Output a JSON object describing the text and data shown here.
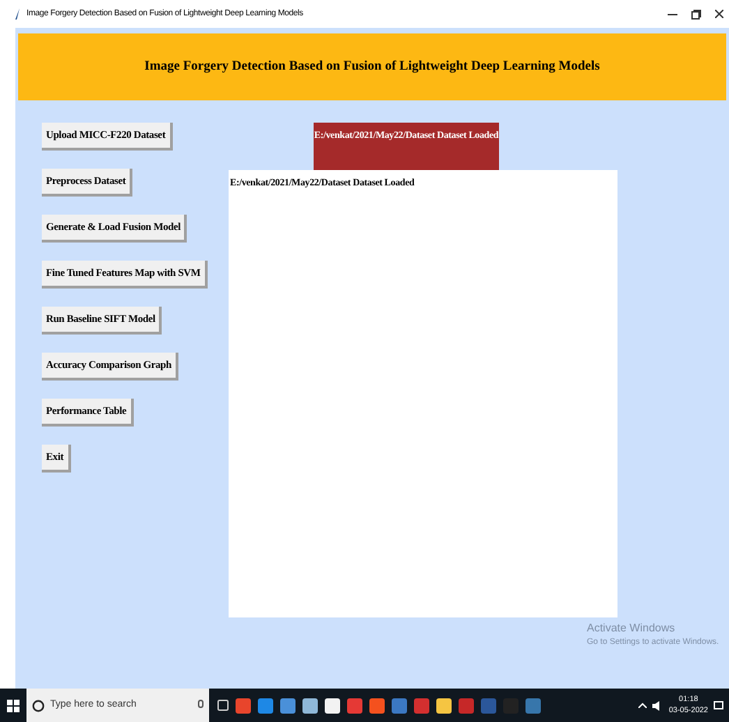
{
  "window": {
    "title": "Image Forgery Detection Based on Fusion of Lightweight Deep Learning Models"
  },
  "header": {
    "title": "Image Forgery Detection Based on Fusion of Lightweight Deep Learning Models"
  },
  "buttons": [
    {
      "label": "Upload MICC-F220 Dataset"
    },
    {
      "label": "Preprocess Dataset"
    },
    {
      "label": "Generate & Load Fusion Model"
    },
    {
      "label": "Fine Tuned Features Map with SVM"
    },
    {
      "label": "Run Baseline SIFT Model"
    },
    {
      "label": "Accuracy Comparison Graph"
    },
    {
      "label": "Performance Table"
    },
    {
      "label": "Exit"
    }
  ],
  "status_label": "E:/venkat/2021/May22/Dataset Dataset Loaded",
  "output_text": "E:/venkat/2021/May22/Dataset Dataset Loaded",
  "activation_notice": {
    "title": "Activate Windows",
    "subtitle": "Go to Settings to activate Windows."
  },
  "taskbar": {
    "search": {
      "placeholder": "Type here to search"
    },
    "time": "01:18",
    "date": "03-05-2022"
  }
}
